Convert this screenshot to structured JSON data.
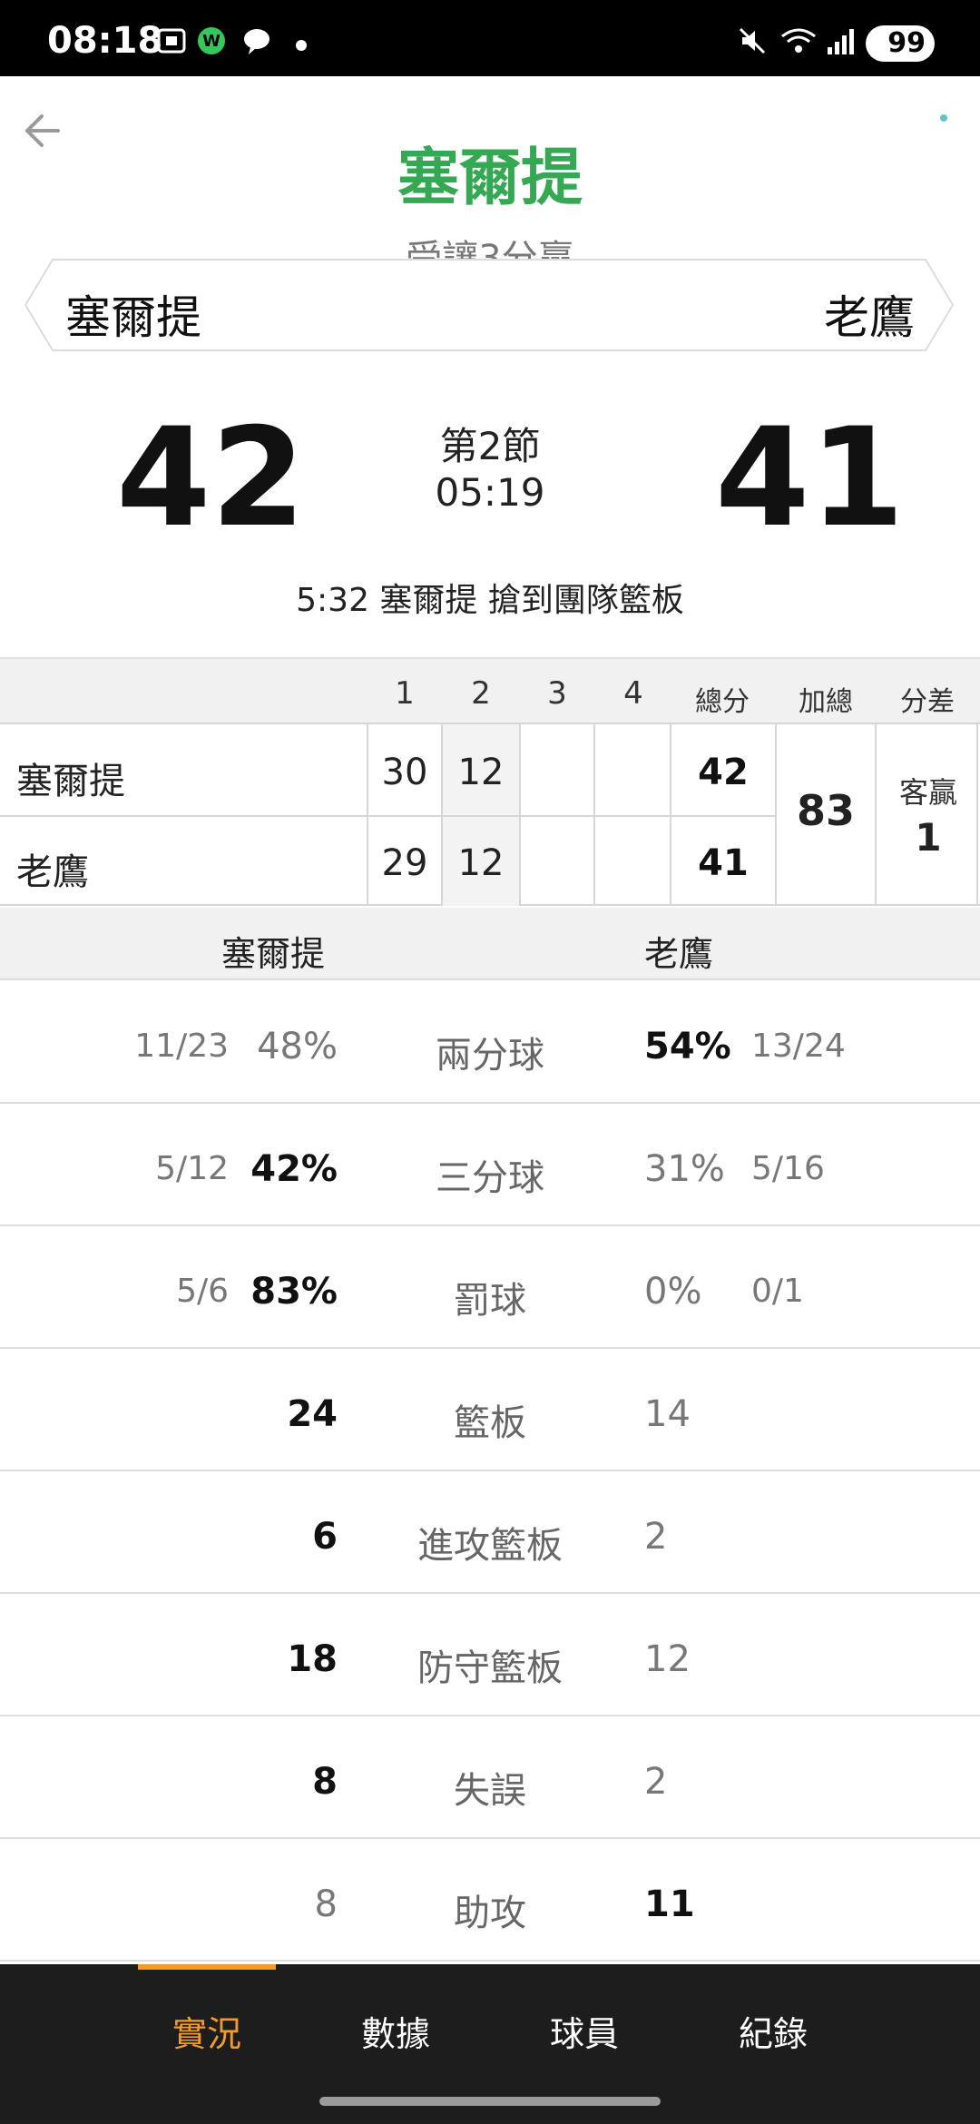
{
  "status_bar": {
    "time": "08:18",
    "battery": "99"
  },
  "header": {
    "title": "塞爾提",
    "subtitle": "受讓3分贏",
    "home_team": "塞爾提",
    "away_team": "老鷹"
  },
  "score": {
    "home": "42",
    "away": "41",
    "period": "第2節",
    "clock": "05:19",
    "last_play": "5:32 塞爾提  搶到團隊籃板"
  },
  "quarter_table": {
    "headers": [
      "1",
      "2",
      "3",
      "4",
      "總分",
      "加總",
      "分差"
    ],
    "rows": [
      {
        "team": "塞爾提",
        "q1": "30",
        "q2": "12",
        "q3": "",
        "q4": "",
        "total": "42"
      },
      {
        "team": "老鷹",
        "q1": "29",
        "q2": "12",
        "q3": "",
        "q4": "",
        "total": "41"
      }
    ],
    "sum": "83",
    "diff_label": "客贏",
    "diff_value": "1"
  },
  "stats": {
    "home_team": "塞爾提",
    "away_team": "老鷹",
    "rows": [
      {
        "label": "兩分球",
        "home_frac": "11/23",
        "home_val": "48%",
        "away_val": "54%",
        "away_frac": "13/24",
        "leader": "away"
      },
      {
        "label": "三分球",
        "home_frac": "5/12",
        "home_val": "42%",
        "away_val": "31%",
        "away_frac": "5/16",
        "leader": "home"
      },
      {
        "label": "罰球",
        "home_frac": "5/6",
        "home_val": "83%",
        "away_val": "0%",
        "away_frac": "0/1",
        "leader": "home"
      },
      {
        "label": "籃板",
        "home_frac": "",
        "home_val": "24",
        "away_val": "14",
        "away_frac": "",
        "leader": "home"
      },
      {
        "label": "進攻籃板",
        "home_frac": "",
        "home_val": "6",
        "away_val": "2",
        "away_frac": "",
        "leader": "home"
      },
      {
        "label": "防守籃板",
        "home_frac": "",
        "home_val": "18",
        "away_val": "12",
        "away_frac": "",
        "leader": "home"
      },
      {
        "label": "失誤",
        "home_frac": "",
        "home_val": "8",
        "away_val": "2",
        "away_frac": "",
        "leader": "home"
      },
      {
        "label": "助攻",
        "home_frac": "",
        "home_val": "8",
        "away_val": "11",
        "away_frac": "",
        "leader": "away"
      }
    ]
  },
  "tabs": [
    {
      "label": "實況",
      "active": true
    },
    {
      "label": "數據",
      "active": false
    },
    {
      "label": "球員",
      "active": false
    },
    {
      "label": "紀錄",
      "active": false
    }
  ],
  "colors": {
    "accent": "#34a853",
    "tab_active": "#f19b2c",
    "tab_bar": "#1d1d1d"
  },
  "icons": [
    "back-arrow-icon",
    "screenshot-icon",
    "webtoon-icon",
    "chat-icon",
    "mute-icon",
    "wifi-icon",
    "signal-icon"
  ]
}
